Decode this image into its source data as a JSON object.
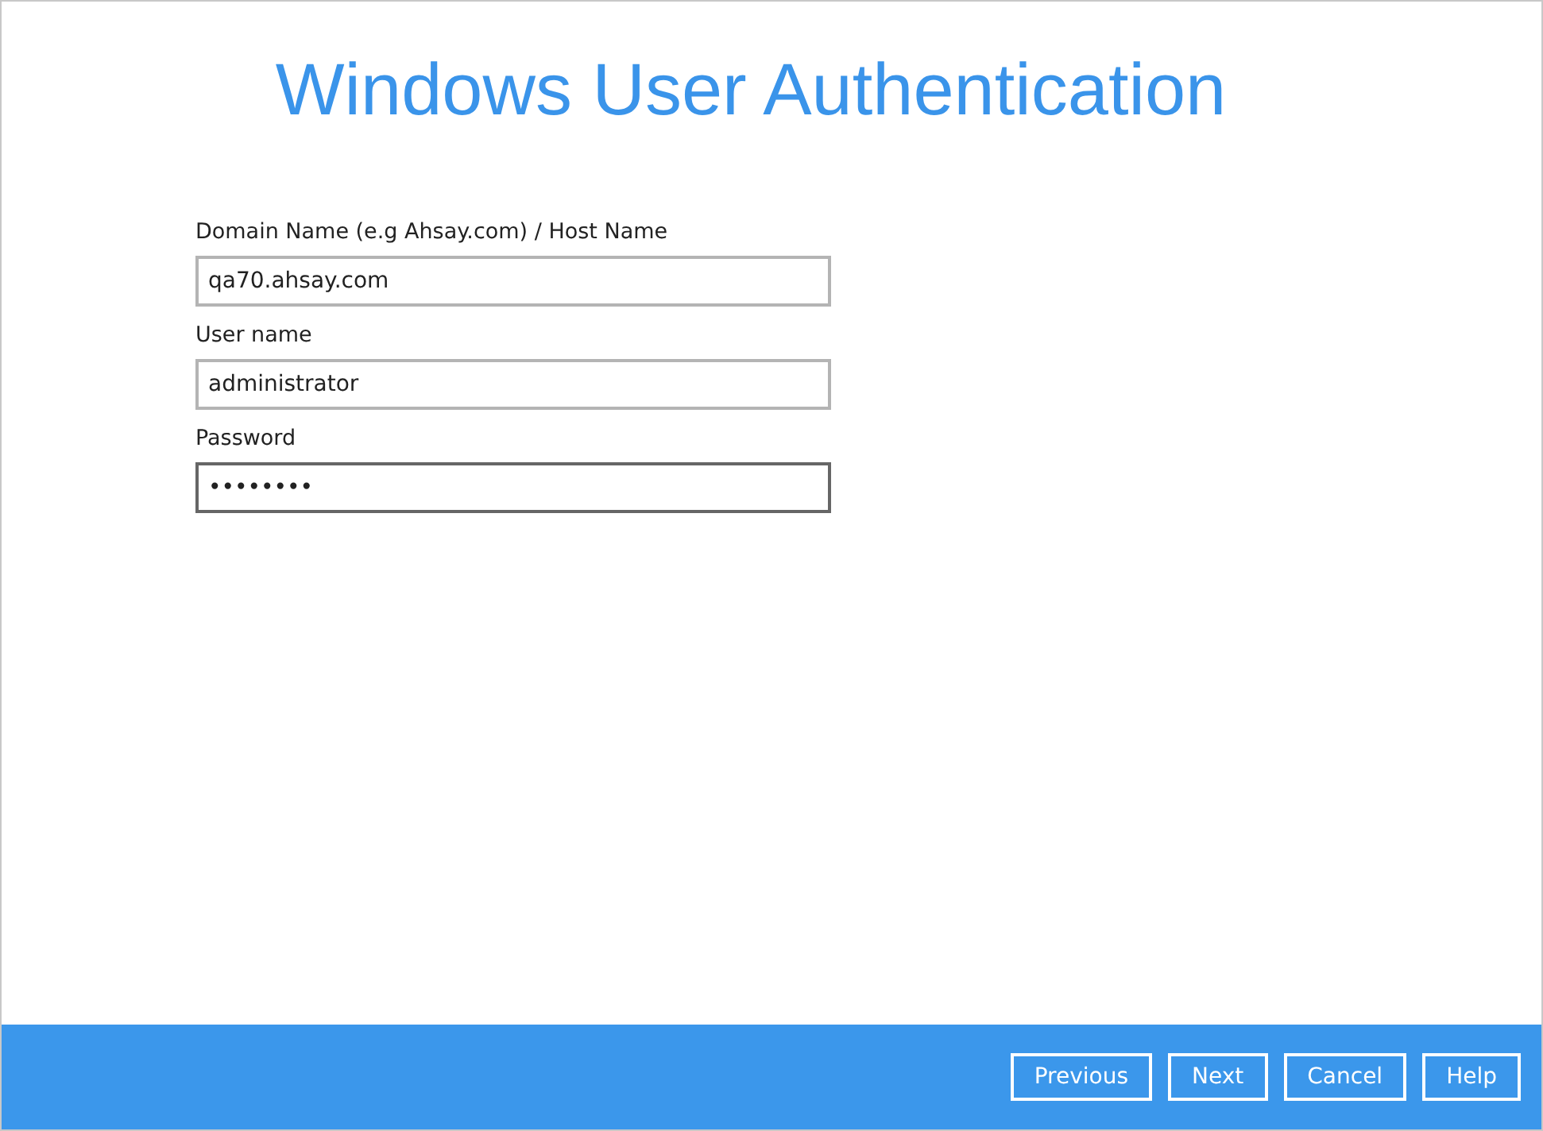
{
  "title": "Windows User Authentication",
  "fields": [
    {
      "label": "Domain Name (e.g Ahsay.com) / Host Name",
      "value": "qa70.ahsay.com",
      "focused": false
    },
    {
      "label": "User name",
      "value": "administrator",
      "focused": false
    },
    {
      "label": "Password",
      "value": "••••••••",
      "focused": true
    }
  ],
  "buttons": [
    "Previous",
    "Next",
    "Cancel",
    "Help"
  ]
}
